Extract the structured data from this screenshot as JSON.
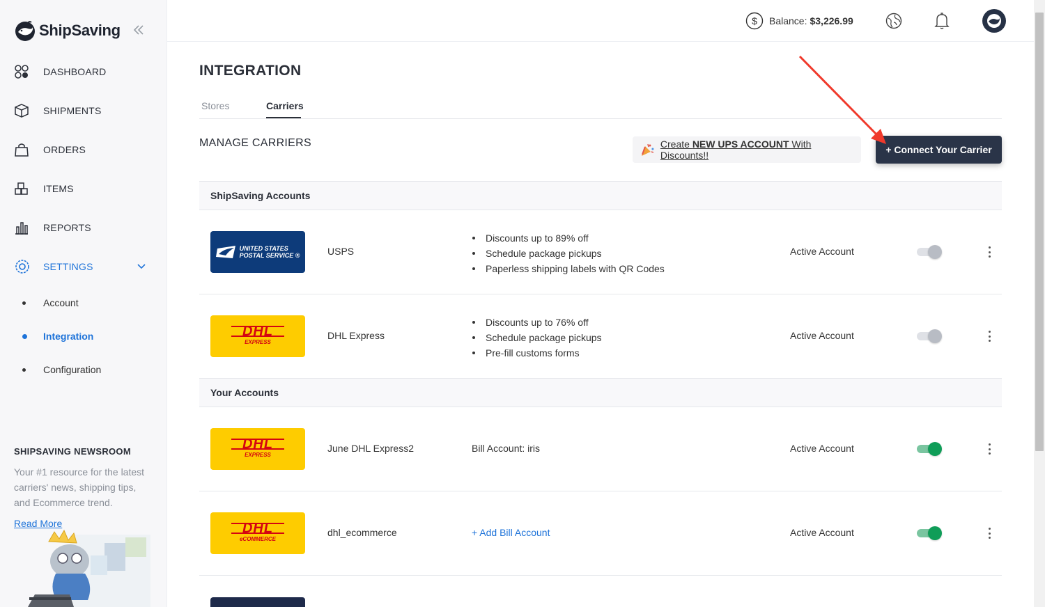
{
  "brand": {
    "name": "ShipSaving"
  },
  "sidebar": {
    "items": [
      {
        "label": "DASHBOARD",
        "icon": "dashboard-icon"
      },
      {
        "label": "SHIPMENTS",
        "icon": "box-icon"
      },
      {
        "label": "ORDERS",
        "icon": "shopping-bag-icon"
      },
      {
        "label": "ITEMS",
        "icon": "boxes-icon"
      },
      {
        "label": "REPORTS",
        "icon": "bar-chart-icon"
      },
      {
        "label": "SETTINGS",
        "icon": "gear-icon",
        "active": true
      }
    ],
    "subitems": [
      {
        "label": "Account"
      },
      {
        "label": "Integration",
        "active": true
      },
      {
        "label": "Configuration"
      }
    ],
    "newsroom": {
      "title": "SHIPSAVING NEWSROOM",
      "desc": "Your #1 resource for the latest carriers' news, shipping tips, and Ecommerce trend.",
      "link": "Read More"
    }
  },
  "topbar": {
    "balance_label": "Balance:",
    "balance_value": "$3,226.99"
  },
  "page": {
    "title": "INTEGRATION",
    "tabs": [
      {
        "label": "Stores"
      },
      {
        "label": "Carriers",
        "active": true
      }
    ],
    "section_title": "MANAGE CARRIERS",
    "promo": {
      "pre": "Create ",
      "bold": "NEW UPS ACCOUNT",
      "post": " With Discounts!!"
    },
    "connect_button": "+ Connect Your Carrier"
  },
  "groups": [
    {
      "header": "ShipSaving Accounts",
      "rows": [
        {
          "name": "USPS",
          "logo": "usps",
          "logo_line1": "UNITED STATES",
          "logo_line2": "POSTAL SERVICE ®",
          "features": [
            "Discounts up to 89% off",
            "Schedule package pickups",
            "Paperless shipping labels with QR Codes"
          ],
          "status": "Active Account",
          "enabled": false
        },
        {
          "name": "DHL Express",
          "logo": "dhl",
          "logo_word": "DHL",
          "logo_sub": "EXPRESS",
          "features": [
            "Discounts up to 76% off",
            "Schedule package pickups",
            "Pre-fill customs forms"
          ],
          "status": "Active Account",
          "enabled": false
        }
      ]
    },
    {
      "header": "Your Accounts",
      "rows": [
        {
          "name": "June DHL Express2",
          "logo": "dhl",
          "logo_word": "DHL",
          "logo_sub": "EXPRESS",
          "info": "Bill Account: iris",
          "status": "Active Account",
          "enabled": true
        },
        {
          "name": "dhl_ecommerce",
          "logo": "dhl",
          "logo_word": "DHL",
          "logo_sub": "eCOMMERCE",
          "add_bill": "+ Add Bill Account",
          "status": "Active Account",
          "enabled": true
        }
      ]
    }
  ],
  "colors": {
    "accent": "#1e73d9",
    "primary_button": "#2a3448",
    "toggle_on": "#0f9d58",
    "dhl_yellow": "#fecc00",
    "dhl_red": "#d40511",
    "usps_blue": "#0d3b7a",
    "annotation_arrow": "#f0392b"
  }
}
